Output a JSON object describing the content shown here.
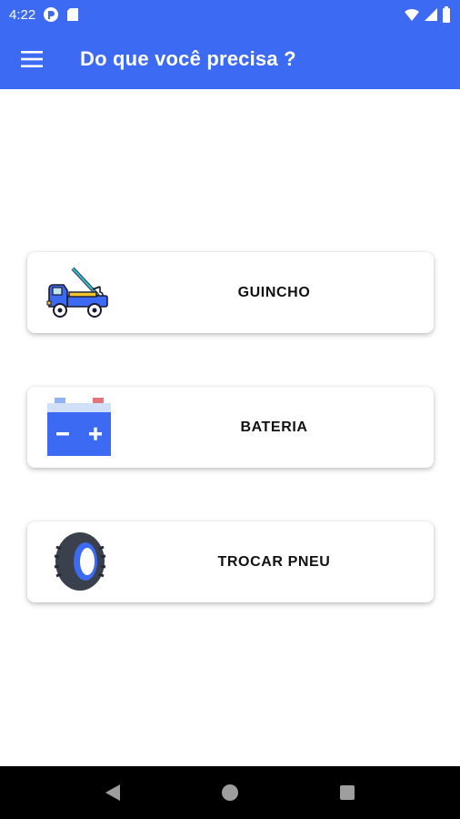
{
  "status_bar": {
    "time": "4:22"
  },
  "app_bar": {
    "title": "Do que você precisa ?"
  },
  "options": [
    {
      "label": "GUINCHO",
      "icon": "tow-truck-icon"
    },
    {
      "label": "BATERIA",
      "icon": "battery-icon"
    },
    {
      "label": "TROCAR PNEU",
      "icon": "tire-icon"
    }
  ],
  "colors": {
    "primary": "#3d6af2",
    "nav": "#000000"
  }
}
